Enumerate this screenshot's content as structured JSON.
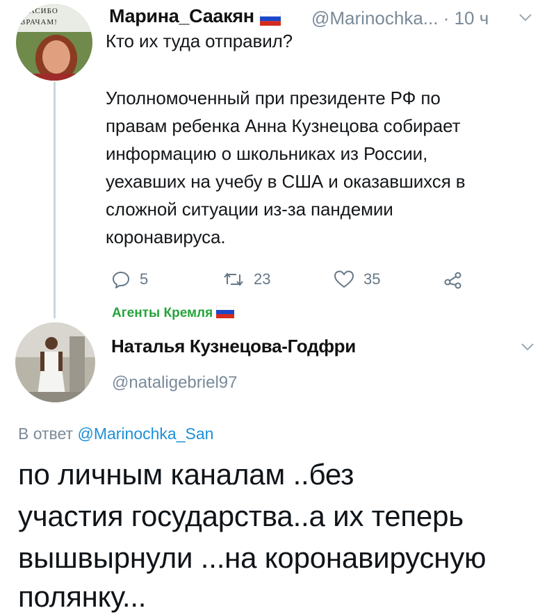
{
  "tweet1": {
    "display_name": "Марина_Саакян",
    "handle": "@Marinochka...",
    "time": "· 10 ч",
    "avatar_sign": [
      "ПАСИБО",
      "ВРАЧАМ!"
    ],
    "text_lines": [
      "Кто их туда отправил?",
      "Уполномоченный при президенте РФ по",
      "правам ребенка Анна Кузнецова собирает",
      "информацию о школьниках из России,",
      "уехавших на учебу в США и оказавшихся в",
      "сложной ситуации из-за пандемии",
      "коронавируса."
    ],
    "actions": {
      "replies": "5",
      "retweets": "23",
      "likes": "35"
    },
    "colors": {
      "accent": "#1d8fd8",
      "muted": "#657786",
      "agents": "#26a43a"
    }
  },
  "agents_label": "Агенты Кремля",
  "tweet2": {
    "display_name": "Наталья Кузнецова-Годфри",
    "handle": "@nataligebriel97",
    "reply_prefix": "В ответ",
    "reply_to": "@Marinochka_San",
    "text_lines": [
      "по личным каналам ..без",
      "участия государства..а их теперь",
      "вышвырнули ...на коронавирусную",
      "полянку..."
    ]
  }
}
